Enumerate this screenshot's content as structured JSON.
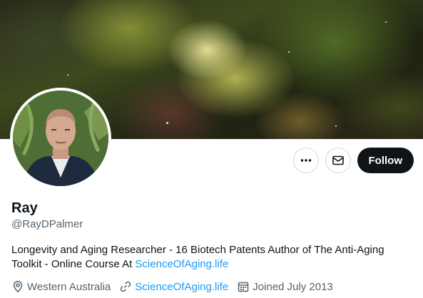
{
  "banner": {
    "description_icon": "nebula-banner"
  },
  "profile": {
    "name": "Ray",
    "handle": "@RayDPalmer",
    "bio_text": "Longevity and Aging Researcher - 16 Biotech Patents Author of The Anti-Aging Toolkit - Online Course At ",
    "bio_link": "ScienceOfAging.life"
  },
  "actions": {
    "more_icon": "more-icon",
    "message_icon": "mail-icon",
    "follow_label": "Follow"
  },
  "meta": {
    "location": "Western Australia",
    "website": "ScienceOfAging.life",
    "joined": "Joined July 2013"
  },
  "colors": {
    "text": "#0f1419",
    "secondary": "#536471",
    "link": "#1d9bf0",
    "follow_bg": "#0f1419"
  }
}
